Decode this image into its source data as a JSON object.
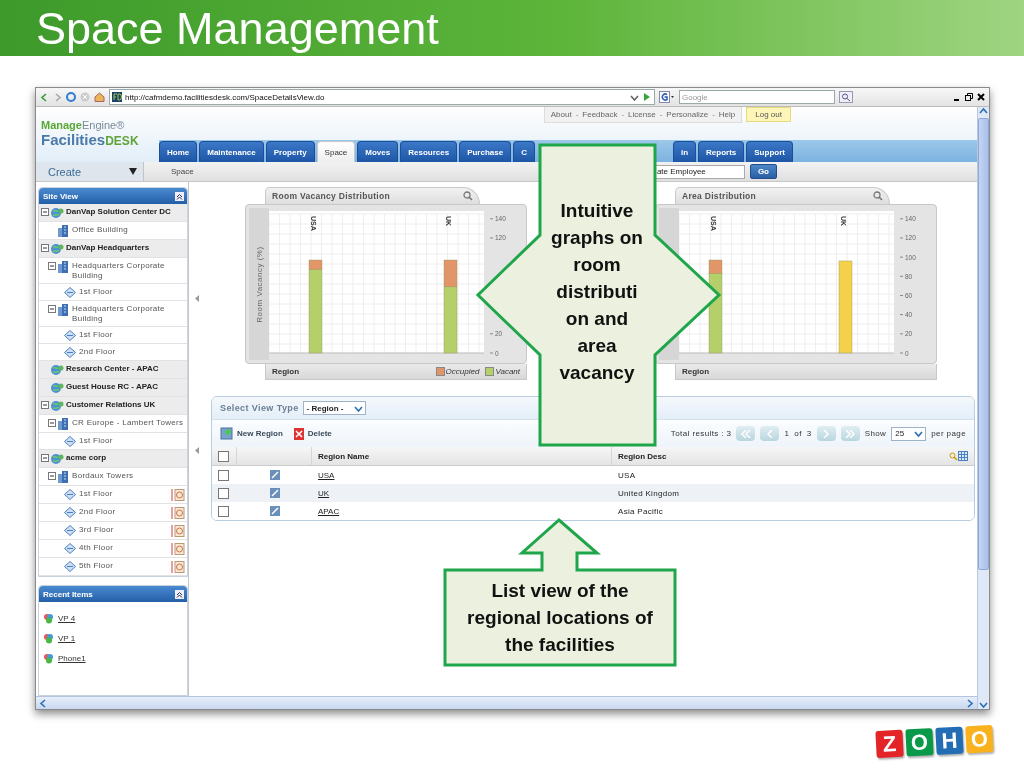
{
  "slide": {
    "title": "Space Management"
  },
  "browser": {
    "address": "http://cafmdemo.facilitiesdesk.com/SpaceDetailsView.do",
    "search": {
      "placeholder": "Google"
    }
  },
  "header": {
    "logo": {
      "brand": "Manage",
      "brand_suffix": "Engine®",
      "product": "Facilities",
      "product_suffix": "DESK"
    },
    "top_links": [
      "About",
      "Feedback",
      "License",
      "Personalize",
      "Help"
    ],
    "separator": "-",
    "logout": "Log out"
  },
  "tabs": [
    {
      "label": "Home",
      "selected": false
    },
    {
      "label": "Maintenance",
      "selected": false
    },
    {
      "label": "Property",
      "selected": false
    },
    {
      "label": "Space",
      "selected": true
    },
    {
      "label": "Moves",
      "selected": false
    },
    {
      "label": "Resources",
      "selected": false
    },
    {
      "label": "Purchase",
      "selected": false
    },
    {
      "label": "C",
      "selected": false
    },
    {
      "label": "in",
      "selected": false
    },
    {
      "label": "Reports",
      "selected": false
    },
    {
      "label": "Support",
      "selected": false
    }
  ],
  "subbar": {
    "create": "Create",
    "breadcrumb": "Space",
    "search": {
      "value": "ate Employee"
    },
    "go": "Go"
  },
  "site_view": {
    "title": "Site View",
    "tree": [
      {
        "label": "DanVap Solution Center DC",
        "kind": "site",
        "expanded": true,
        "children": [
          {
            "label": "Office Building",
            "kind": "building"
          }
        ]
      },
      {
        "label": "DanVap Headquarters",
        "kind": "site",
        "expanded": true,
        "children": [
          {
            "label": "Headquarters Corporate Building",
            "kind": "building",
            "expanded": true,
            "children": [
              {
                "label": "1st Floor",
                "kind": "floor",
                "gauge": false
              }
            ]
          },
          {
            "label": "Headquarters Corporate Building",
            "kind": "building",
            "expanded": true,
            "children": [
              {
                "label": "1st Floor",
                "kind": "floor",
                "gauge": false
              },
              {
                "label": "2nd Floor",
                "kind": "floor",
                "gauge": false
              }
            ]
          }
        ]
      },
      {
        "label": "Research Center - APAC",
        "kind": "site"
      },
      {
        "label": "Guest House RC - APAC",
        "kind": "site"
      },
      {
        "label": "Customer Relations UK",
        "kind": "site",
        "expanded": true,
        "children": [
          {
            "label": "CR Europe - Lambert Towers",
            "kind": "building",
            "expanded": true,
            "children": [
              {
                "label": "1st Floor",
                "kind": "floor",
                "gauge": false
              }
            ]
          }
        ]
      },
      {
        "label": "acme corp",
        "kind": "site",
        "expanded": true,
        "children": [
          {
            "label": "Bordaux Towers",
            "kind": "building",
            "expanded": true,
            "children": [
              {
                "label": "1st Floor",
                "kind": "floor",
                "gauge": true
              },
              {
                "label": "2nd Floor",
                "kind": "floor",
                "gauge": true
              },
              {
                "label": "3rd Floor",
                "kind": "floor",
                "gauge": true
              },
              {
                "label": "4th Floor",
                "kind": "floor",
                "gauge": true
              },
              {
                "label": "5th Floor",
                "kind": "floor",
                "gauge": true
              }
            ]
          }
        ]
      }
    ]
  },
  "recent_items": {
    "title": "Recent Items",
    "items": [
      "VP 4",
      "VP 1",
      "Phone1"
    ]
  },
  "charts": [
    {
      "title": "Room Vacancy Distribution",
      "chart_data": {
        "type": "bar",
        "xlabel": "Region",
        "ylabel": "Room Vacancy (%)",
        "categories": [
          "USA",
          "UK"
        ],
        "stacked": true,
        "grid": true,
        "legend": "bottom",
        "ylim": [
          0,
          145
        ],
        "yticks": [
          0,
          20,
          120,
          140
        ],
        "series": [
          {
            "name": "Vacant",
            "color": "#b5cf6b",
            "values": [
              87,
              69
            ]
          },
          {
            "name": "Occupied",
            "color": "#e3956a",
            "values": [
              10,
              28
            ]
          }
        ]
      }
    },
    {
      "title": "Area Distribution",
      "chart_data": {
        "type": "bar",
        "xlabel": "Region",
        "categories": [
          "USA",
          "UK"
        ],
        "stacked": true,
        "grid": true,
        "ylim": [
          0,
          145
        ],
        "yticks": [
          0,
          20,
          40,
          60,
          80,
          100,
          120,
          140
        ],
        "series": [
          {
            "color": "#b5cf6b",
            "values": [
              83,
              null
            ]
          },
          {
            "color": "#e3956a",
            "values": [
              14,
              null
            ]
          },
          {
            "color": "#f5d04a",
            "values": [
              null,
              96
            ]
          }
        ]
      }
    }
  ],
  "list": {
    "view_type_label": "Select View Type",
    "view_type": "- Region -",
    "actions": [
      {
        "label": "New Region",
        "kind": "new"
      },
      {
        "label": "Delete",
        "kind": "delete"
      }
    ],
    "paging": {
      "total": "Total results : 3",
      "page": "1",
      "of": "of",
      "pages": "3",
      "show": "Show",
      "per_page": "25",
      "suffix": "per page"
    },
    "table": {
      "columns": [
        "Region Name",
        "Region Desc"
      ],
      "all_checked": false,
      "rows": [
        {
          "checked": false,
          "name": "USA",
          "desc": "USA"
        },
        {
          "checked": false,
          "name": "UK",
          "desc": "United Kingdom"
        },
        {
          "checked": false,
          "name": "APAC",
          "desc": "Asia Pacific"
        }
      ]
    }
  },
  "callouts": [
    {
      "kind": "left_right",
      "text": "Intuitive graphs on room distributi on and area vacancy"
    },
    {
      "kind": "up",
      "text": "List view of the regional locations of the facilities"
    }
  ],
  "zoho": {
    "letters": [
      {
        "text": "Z",
        "color": "#e42527"
      },
      {
        "text": "O",
        "color": "#089949"
      },
      {
        "text": "H",
        "color": "#226db4"
      },
      {
        "text": "O",
        "color": "#f9b21d"
      }
    ]
  }
}
